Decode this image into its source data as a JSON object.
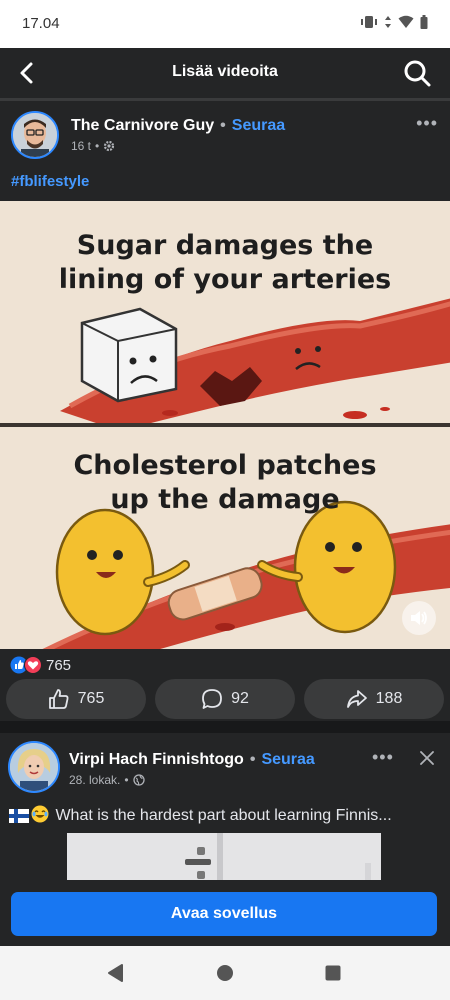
{
  "status_bar": {
    "time": "17.04"
  },
  "header": {
    "title": "Lisää videoita",
    "back_icon": "chevron-left-icon",
    "search_icon": "search-icon"
  },
  "post1": {
    "author": "The Carnivore Guy",
    "follow": "Seuraa",
    "time": "16 t",
    "hashtag": "#fblifestyle",
    "image": {
      "caption_top": [
        "Sugar damages the",
        "lining of your arteries"
      ],
      "caption_bottom": [
        "Cholesterol patches",
        "up the damage"
      ]
    },
    "reactions_count": "765",
    "actions": {
      "like_count": "765",
      "comment_count": "92",
      "share_count": "188"
    }
  },
  "post2": {
    "author": "Virpi Hach Finnishtogo",
    "follow": "Seuraa",
    "date": "28. lokak.",
    "text": "What is the hardest part about learning Finnis..."
  },
  "open_app": {
    "label": "Avaa sovellus"
  },
  "colors": {
    "accent": "#1877f2",
    "link": "#4599ff",
    "bg_dark": "#242526"
  }
}
